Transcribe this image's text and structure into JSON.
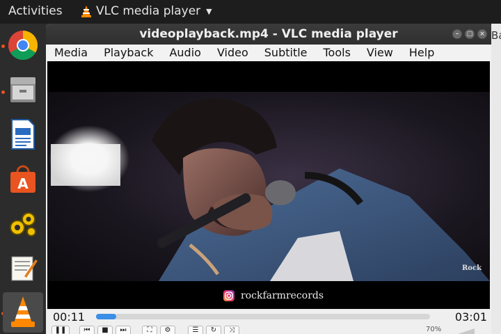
{
  "topbar": {
    "activities": "Activities",
    "app_name": "VLC media player"
  },
  "dock": {
    "items": [
      "chrome",
      "files",
      "writer",
      "software",
      "settings",
      "text-editor",
      "vlc"
    ]
  },
  "window": {
    "title": "videoplayback.mp4 - VLC media player"
  },
  "menu": [
    "Media",
    "Playback",
    "Audio",
    "Video",
    "Subtitle",
    "Tools",
    "View",
    "Help"
  ],
  "video": {
    "watermark_handle": "rockfarmrecords",
    "logo_text": "Rock"
  },
  "player": {
    "elapsed": "00:11",
    "total": "03:01",
    "progress": 0.06,
    "volume": "70%"
  },
  "background_window": {
    "partial_text": "Ba"
  },
  "colors": {
    "accent": "#e95420",
    "seek_fill": "#3a8ee6",
    "vlc_orange": "#ff8800"
  }
}
